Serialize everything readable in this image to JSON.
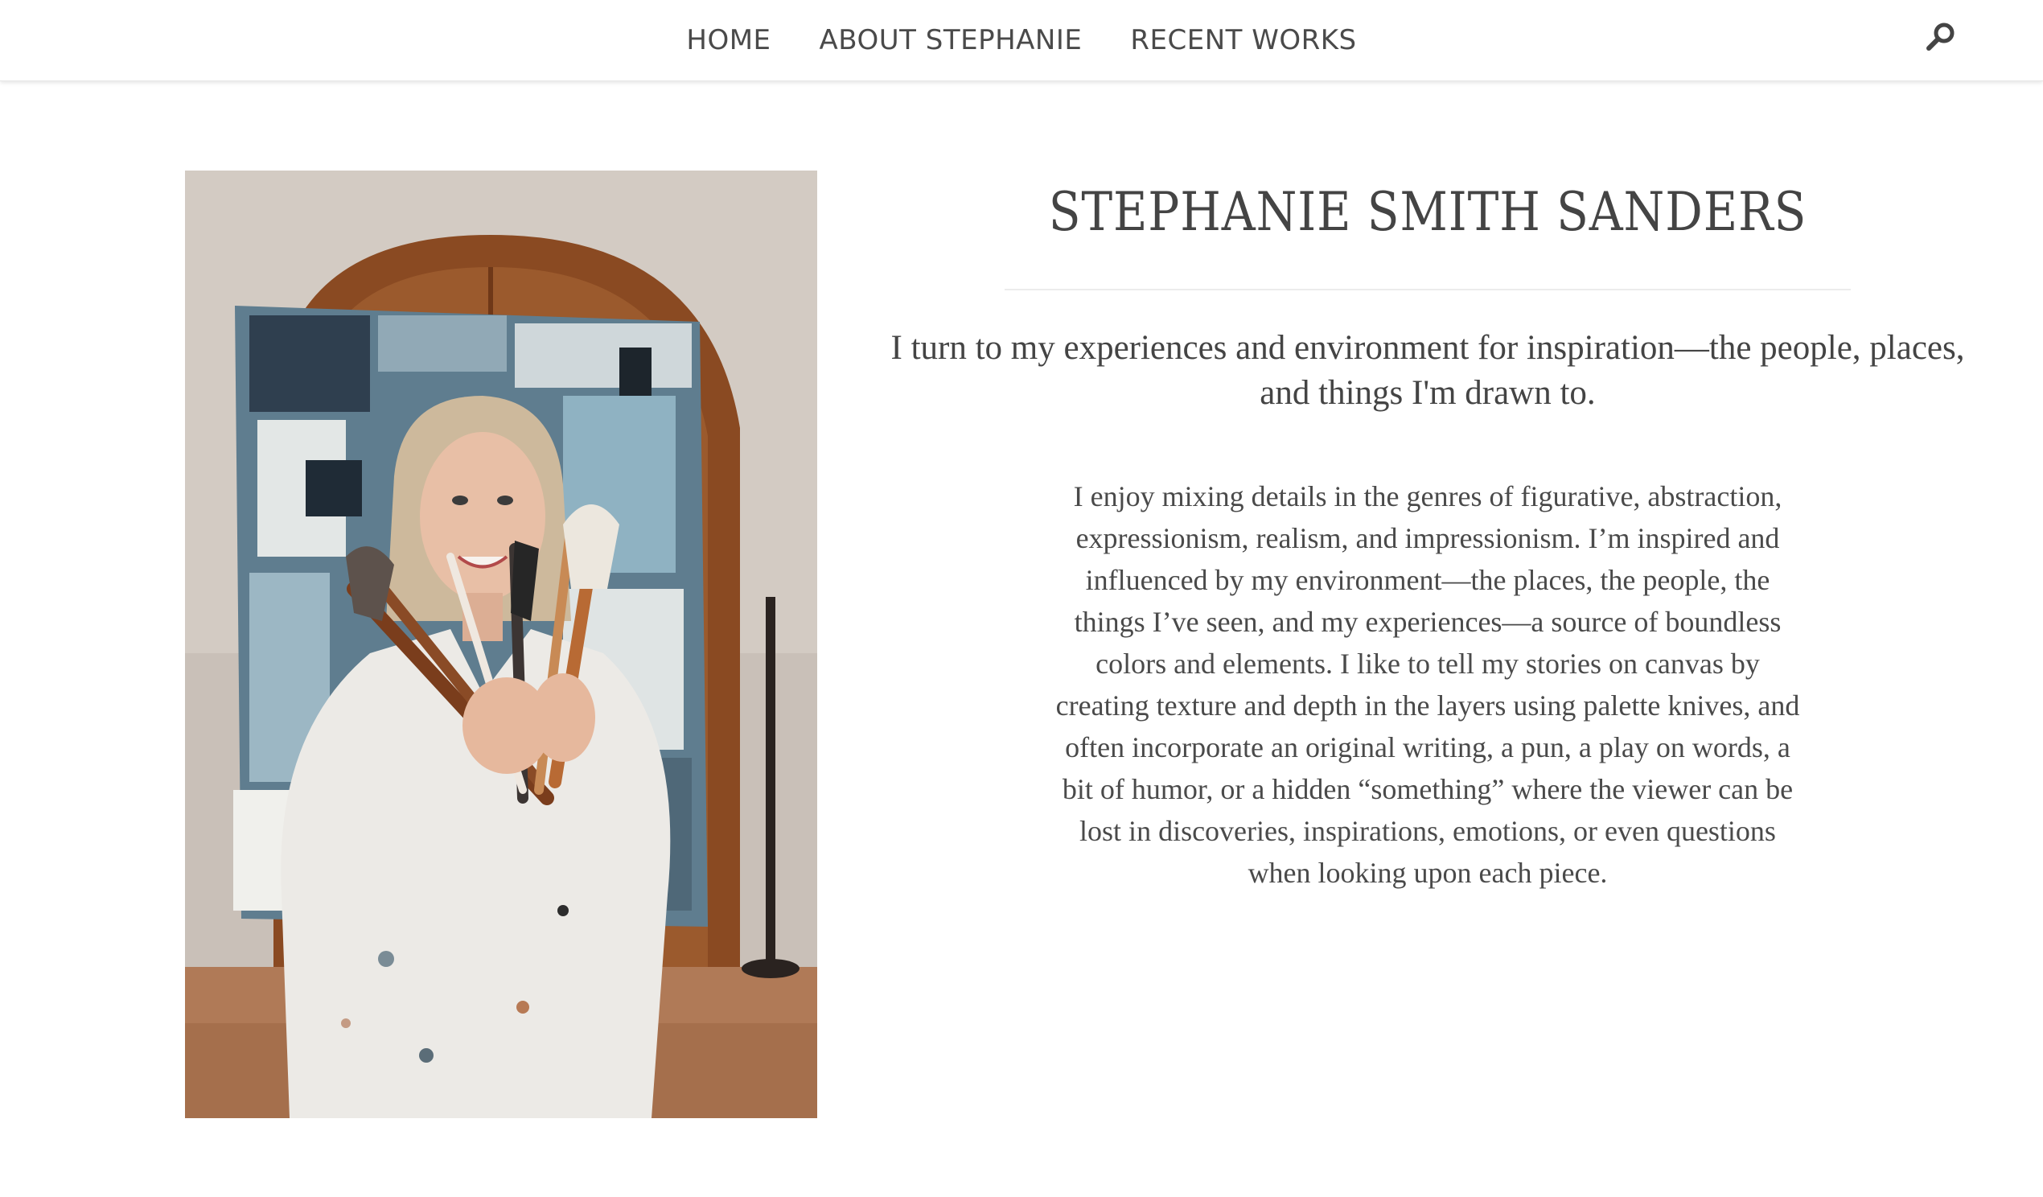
{
  "nav": {
    "items": [
      {
        "label": "HOME"
      },
      {
        "label": "ABOUT STEPHANIE"
      },
      {
        "label": "RECENT WORKS"
      }
    ],
    "search_icon": "search-icon"
  },
  "portrait": {
    "alt": "Stephanie Smith Sanders holding a bundle of paint brushes in front of an abstract painting"
  },
  "main": {
    "name": "STEPHANIE SMITH SANDERS",
    "lead": "I turn to my experiences and environment for inspiration—the people, places, and things I'm drawn to.",
    "body": "I enjoy mixing details in the genres of figurative, abstraction, expressionism, realism, and impressionism. I’m inspired and influenced by my environment—the places, the people, the things I’ve seen, and my experiences—a source of boundless colors and elements. I like to tell my stories on canvas by creating texture and depth in the layers using palette knives, and often incorporate an original writing, a pun, a play on words, a bit of humor, or a hidden “something” where the viewer can be lost in discoveries, inspirations, emotions, or even questions when looking upon each piece."
  },
  "colors": {
    "text": "#4a4a4a",
    "heading": "#444444",
    "divider": "#ececec",
    "background": "#ffffff"
  }
}
